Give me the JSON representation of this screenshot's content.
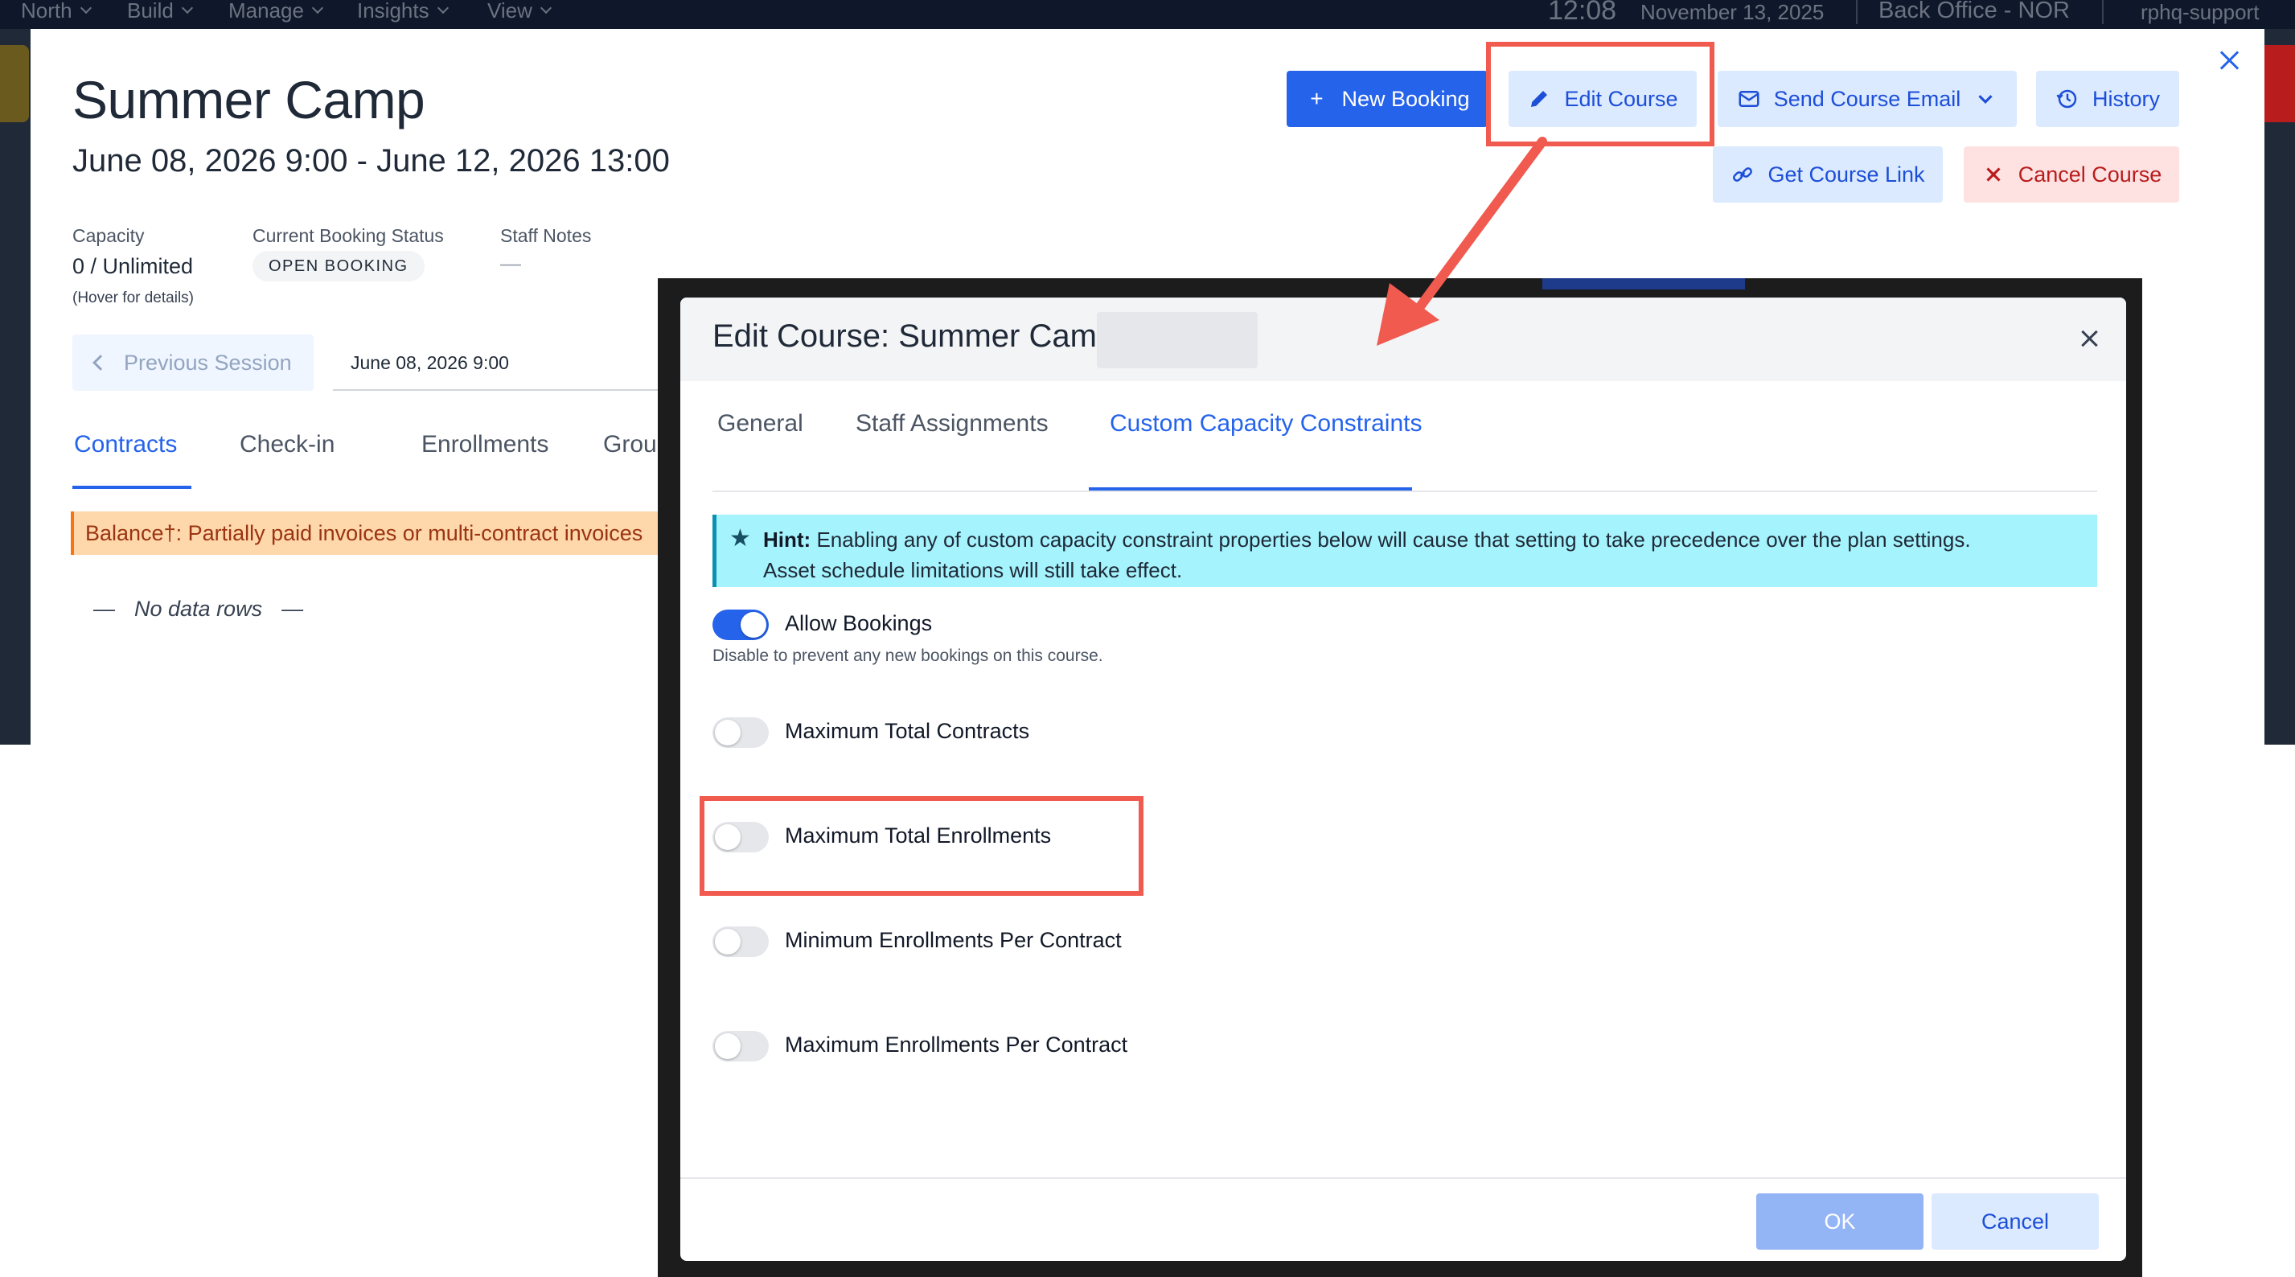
{
  "topnav": {
    "items": [
      "North",
      "Build",
      "Manage",
      "Insights",
      "View"
    ],
    "time": "12:08",
    "date": "November 13, 2025",
    "office": "Back Office - NOR",
    "user": "rphq-support"
  },
  "course": {
    "title": "Summer Camp",
    "dates": "June 08, 2026 9:00 - June 12, 2026 13:00",
    "capacity_label": "Capacity",
    "capacity_value": "0 / Unlimited",
    "capacity_hint": "(Hover for details)",
    "status_label": "Current Booking Status",
    "status_badge": "OPEN BOOKING",
    "notes_label": "Staff Notes",
    "notes_value": "—"
  },
  "actions": {
    "new_booking": "New Booking",
    "edit_course": "Edit Course",
    "send_email": "Send Course Email",
    "history": "History",
    "get_link": "Get Course Link",
    "cancel_course": "Cancel Course"
  },
  "session": {
    "previous": "Previous Session",
    "current": "June 08, 2026 9:00"
  },
  "tabs": [
    "Contracts",
    "Check-in",
    "Enrollments",
    "Group C"
  ],
  "balance_note": "Balance†: Partially paid invoices or multi-contract invoices",
  "no_data": "No data rows",
  "modal": {
    "title": "Edit Course: Summer Camp",
    "tabs": [
      "General",
      "Staff Assignments",
      "Custom Capacity Constraints"
    ],
    "hint_label": "Hint:",
    "hint_text": "Enabling any of custom capacity constraint properties below will cause that setting to take precedence over the plan settings.",
    "hint_text2": "Asset schedule limitations will still take effect.",
    "toggles": [
      {
        "label": "Allow Bookings",
        "on": true,
        "help": "Disable to prevent any new bookings on this course."
      },
      {
        "label": "Maximum Total Contracts",
        "on": false
      },
      {
        "label": "Maximum Total Enrollments",
        "on": false
      },
      {
        "label": "Minimum Enrollments Per Contract",
        "on": false
      },
      {
        "label": "Maximum Enrollments Per Contract",
        "on": false
      }
    ],
    "ok": "OK",
    "cancel": "Cancel"
  },
  "colors": {
    "primary": "#2563eb",
    "annotation": "#f05a4f",
    "hint_bg": "#a5f3fc",
    "balance_bg": "#fed7aa"
  },
  "icons": [
    "plus-icon",
    "pencil-icon",
    "mail-icon",
    "chevron-down-icon",
    "history-icon",
    "link-icon",
    "close-icon",
    "star-icon",
    "chevron-left-icon"
  ]
}
